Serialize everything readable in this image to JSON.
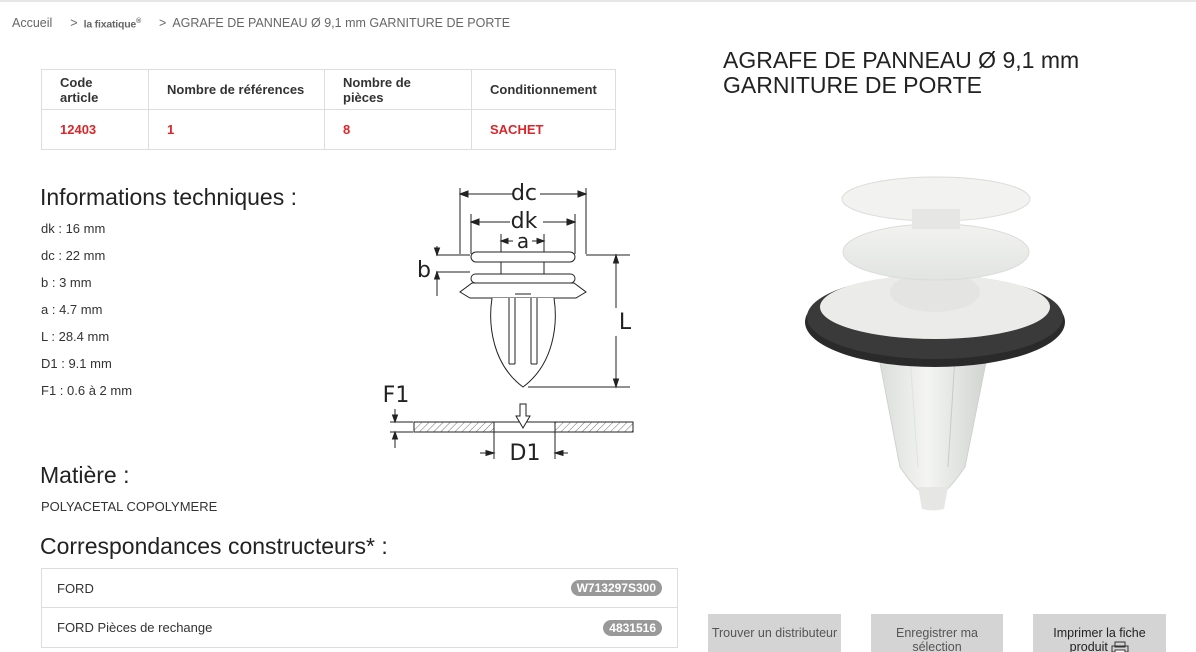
{
  "breadcrumb": {
    "home": "Accueil",
    "sep1": ">",
    "brand": "la fixatique",
    "brand_mark": "®",
    "sep2": ">",
    "current": "AGRAFE DE PANNEAU Ø 9,1 mm GARNITURE DE PORTE"
  },
  "spec_table": {
    "headers": [
      "Code article",
      "Nombre de références",
      "Nombre de pièces",
      "Conditionnement"
    ],
    "values": [
      "12403",
      "1",
      "8",
      "SACHET"
    ]
  },
  "tech_info": {
    "title": "Informations techniques :",
    "items": [
      "dk : 16 mm",
      "dc : 22 mm",
      "b : 3 mm",
      "a : 4.7 mm",
      "L : 28.4 mm",
      "D1 : 9.1 mm",
      "F1 : 0.6 à 2 mm"
    ]
  },
  "diagram_labels": {
    "dc": "dc",
    "dk": "dk",
    "a": "a",
    "b": "b",
    "L": "L",
    "F1": "F1",
    "D1": "D1"
  },
  "material": {
    "title": "Matière :",
    "value": "POLYACETAL COPOLYMERE"
  },
  "correspondences": {
    "title": "Correspondances constructeurs* :",
    "rows": [
      {
        "maker": "FORD",
        "ref": "W713297S300"
      },
      {
        "maker": "FORD Pièces de rechange",
        "ref": "4831516"
      }
    ]
  },
  "product": {
    "title": "AGRAFE DE PANNEAU Ø 9,1 mm GARNITURE DE PORTE"
  },
  "actions": {
    "find_distributor": "Trouver un distributeur",
    "save_selection": "Enregistrer ma sélection",
    "print_sheet": "Imprimer la fiche produit",
    "print_icon": "printer-icon"
  },
  "colors": {
    "accent_red": "#d9262a",
    "badge_grey": "#999999",
    "button_grey": "#d4d4d4"
  }
}
